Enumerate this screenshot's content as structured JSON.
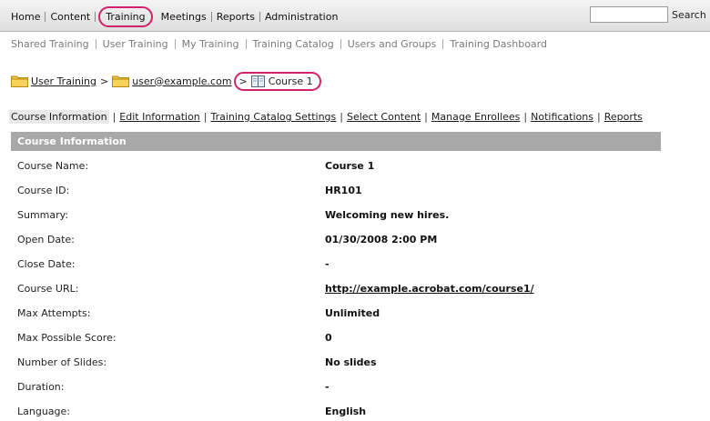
{
  "topnav": {
    "items": [
      "Home",
      "Content",
      "Training",
      "Meetings",
      "Reports",
      "Administration"
    ],
    "search_value": "",
    "search_label": "Search"
  },
  "subnav": {
    "items": [
      "Shared Training",
      "User Training",
      "My Training",
      "Training Catalog",
      "Users and Groups",
      "Training Dashboard"
    ]
  },
  "breadcrumb": {
    "links": [
      "User Training",
      "user@example.com"
    ],
    "separators": [
      ">",
      ">"
    ],
    "current": "Course 1"
  },
  "tabs": [
    "Course Information",
    "Edit Information",
    "Training Catalog Settings",
    "Select Content",
    "Manage Enrollees",
    "Notifications",
    "Reports"
  ],
  "panel": {
    "title": "Course Information",
    "rows": [
      {
        "label": "Course Name:",
        "value": "Course 1"
      },
      {
        "label": "Course ID:",
        "value": "HR101"
      },
      {
        "label": "Summary:",
        "value": "Welcoming new hires."
      },
      {
        "label": "Open Date:",
        "value": "01/30/2008 2:00 PM"
      },
      {
        "label": "Close Date:",
        "value": "-"
      },
      {
        "label": "Course URL:",
        "value": "http://example.acrobat.com/course1/"
      },
      {
        "label": "Max Attempts:",
        "value": "Unlimited"
      },
      {
        "label": "Max Possible Score:",
        "value": "0"
      },
      {
        "label": "Number of Slides:",
        "value": "No slides"
      },
      {
        "label": "Duration:",
        "value": "-"
      },
      {
        "label": "Language:",
        "value": "English"
      }
    ]
  },
  "colors": {
    "highlight_ring": "#d0226b",
    "panel_header": "#a8a8a8",
    "folder": "#f2c53d"
  },
  "icons": {
    "folder": "folder-icon",
    "course": "book-icon"
  }
}
